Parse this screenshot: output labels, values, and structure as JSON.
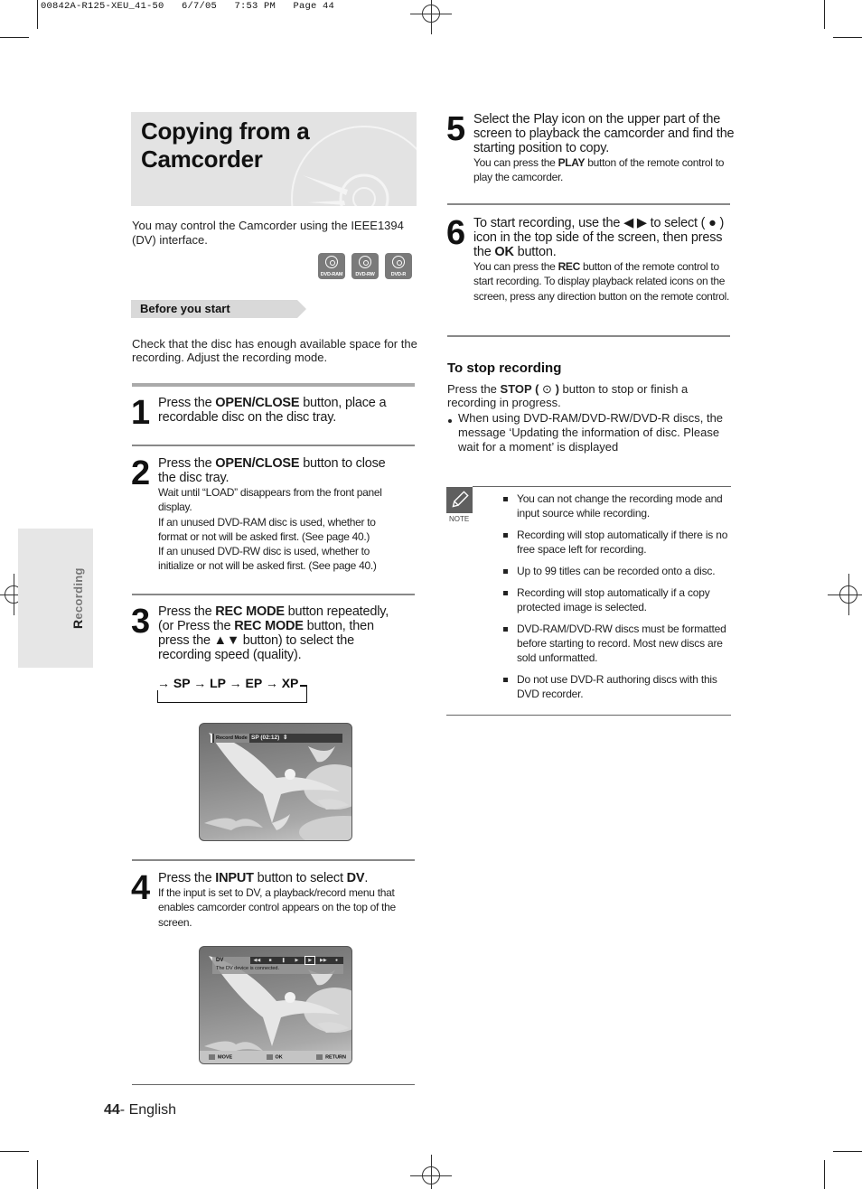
{
  "print_slug": "00842A-R125-XEU_41-50   6/7/05   7:53 PM   Page 44",
  "side_tab": {
    "first_letter": "R",
    "rest": "ecording"
  },
  "title": {
    "line1": "Copying from a",
    "line2": "Camcorder"
  },
  "intro": "You may control the Camcorder using the IEEE1394 (DV) interface.",
  "disc_icons": [
    {
      "label": "DVD-RAM"
    },
    {
      "label": "DVD-RW"
    },
    {
      "label": "DVD-R"
    }
  ],
  "before_start": {
    "heading": "Before you start",
    "text": "Check that the disc has enough available space for the recording. Adjust the recording mode."
  },
  "steps": [
    {
      "num": "1",
      "pre": "Press the ",
      "bold": "OPEN/CLOSE",
      "post": " button, place a recordable disc on the disc tray."
    },
    {
      "num": "2",
      "pre": "Press the ",
      "bold": "OPEN/CLOSE",
      "post": " button to close the disc tray.",
      "sub": [
        "Wait until “LOAD” disappears from the front panel display.",
        "If an unused DVD-RAM disc is used, whether to format or not will be asked first. (See page 40.)",
        "If an unused DVD-RW disc is used, whether to initialize or not will be asked first. (See page 40.)"
      ]
    },
    {
      "num": "3",
      "pre": "Press the ",
      "bold": "REC MODE",
      "mid": " button repeatedly, (or Press the ",
      "bold2": "REC MODE",
      "post": " button, then press the ▲▼ button) to select the recording speed (quality).",
      "speed_chain": "→ SP → LP → EP → XP"
    },
    {
      "num": "4",
      "pre": "Press the ",
      "bold": "INPUT",
      "mid": " button to select ",
      "bold2": "DV",
      "post": ".",
      "sub": [
        "If the input is set to DV, a playback/record menu that enables camcorder control appears on the top of the screen."
      ]
    },
    {
      "num": "5",
      "main": "Select the Play icon on the upper part of the screen to playback the camcorder and find the starting position to copy.",
      "sub_pre": "You can press the ",
      "sub_bold": "PLAY",
      "sub_post": " button of the remote control to play the camcorder."
    },
    {
      "num": "6",
      "pre": "To start recording, use the ◀ ▶ to select ( ● ) icon in the top side of the screen, then press the ",
      "bold": "OK",
      "post": " button.",
      "sub_pre": "You can press the ",
      "sub_bold": "REC",
      "sub_post": " button of the remote control to start recording. To display playback related icons on the screen, press any direction button on the remote control."
    }
  ],
  "screen1": {
    "tag": "Record Mode",
    "value": "SP (02:12)",
    "arrows": "⇕"
  },
  "screen2": {
    "source": "DV",
    "message": "The DV device is connected.",
    "controls": [
      "◀◀",
      "■",
      "❚",
      "▶",
      "▶",
      "▶▶",
      "●"
    ],
    "selected_control": 4,
    "footer": {
      "move": "MOVE",
      "ok": "OK",
      "return": "RETURN"
    }
  },
  "stop_recording": {
    "heading": "To stop recording",
    "pre": "Press the ",
    "bold": "STOP (",
    "symbol": "⊙",
    "bold_close": ")",
    "post": " button to stop or finish a recording in progress.",
    "bullet": "When using DVD-RAM/DVD-RW/DVD-R discs, the message ‘Updating the information of disc. Please wait for a moment’ is displayed"
  },
  "note": {
    "label": "NOTE",
    "items": [
      "You can not change the recording mode and input source while recording.",
      "Recording will stop automatically if there is no free space left for recording.",
      "Up to 99 titles can be recorded onto a disc.",
      "Recording will stop automatically if a copy protected image is selected.",
      "DVD-RAM/DVD-RW discs must be formatted before starting to record. Most new discs are sold unformatted.",
      "Do not use DVD-R authoring discs with this DVD recorder."
    ]
  },
  "footer": {
    "page": "44",
    "lang": "- English"
  }
}
